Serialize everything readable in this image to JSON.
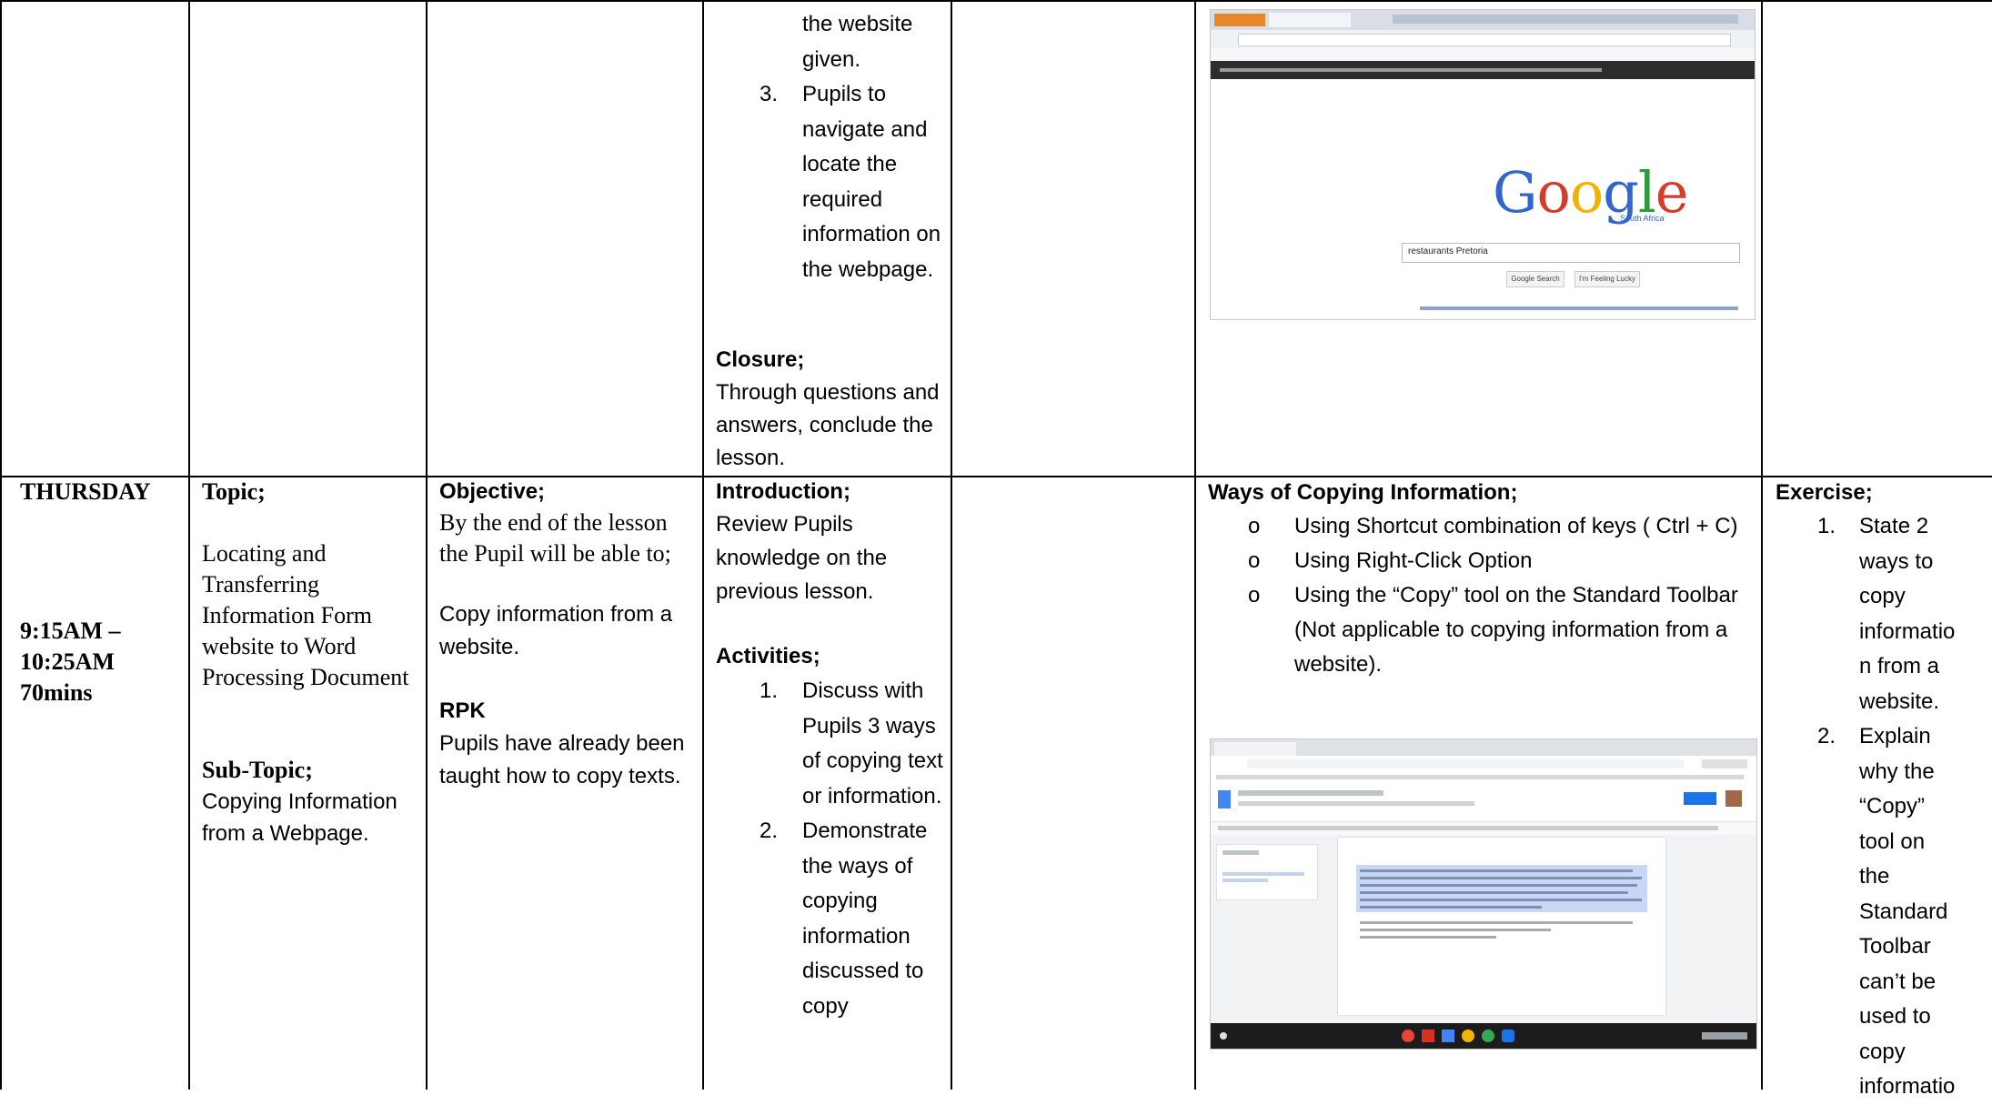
{
  "row1": {
    "activities_tail": {
      "item2_tail": "the website given.",
      "item3_num": "3.",
      "item3_text": "Pupils to navigate and locate the required information on the webpage."
    },
    "closure_heading": "Closure;",
    "closure_text": "Through questions and answers, conclude the lesson."
  },
  "row2": {
    "day": "THURSDAY",
    "time": "9:15AM – 10:25AM 70mins",
    "topic_heading": "Topic;",
    "topic_text": "Locating and Transferring Information Form website to Word Processing Document",
    "subtopic_heading": "Sub-Topic;",
    "subtopic_text": "Copying Information from a Webpage.",
    "objective_heading": "Objective;",
    "objective_text": "By the end of the lesson the Pupil will be able to;",
    "objective_item": "Copy information from a website.",
    "rpk_heading": "RPK",
    "rpk_text": "Pupils have already been taught how to copy texts.",
    "intro_heading": "Introduction;",
    "intro_text": "Review Pupils knowledge on the previous lesson.",
    "activities_heading": "Activities;",
    "activities": [
      {
        "num": "1.",
        "text": "Discuss with Pupils 3 ways of copying text or information."
      },
      {
        "num": "2.",
        "text": "Demonstrate the ways of copying information discussed to copy"
      }
    ],
    "ways_heading": "Ways of Copying Information;",
    "ways": [
      {
        "bullet": "o",
        "text": "Using Shortcut combination of keys ( Ctrl + C)"
      },
      {
        "bullet": "o",
        "text": "Using Right-Click Option"
      },
      {
        "bullet": "o",
        "text": "Using the “Copy” tool on the Standard Toolbar (Not applicable to copying information from a website)."
      }
    ],
    "exercise_heading": "Exercise;",
    "exercises": [
      {
        "num": "1.",
        "text": "State 2 ways to copy informatio n from a website."
      },
      {
        "num": "2.",
        "text": "Explain why the “Copy” tool on the Standard Toolbar can’t be used to copy informatio"
      }
    ]
  },
  "google_shot": {
    "logo": "Google",
    "region": "South Africa",
    "query": "restaurants Pretoria",
    "btn_search": "Google Search",
    "btn_lucky": "I'm Feeling Lucky"
  },
  "colors": {
    "grid": "#000000",
    "google_blue": "#3366cc",
    "highlight": "#c7d7f5"
  }
}
